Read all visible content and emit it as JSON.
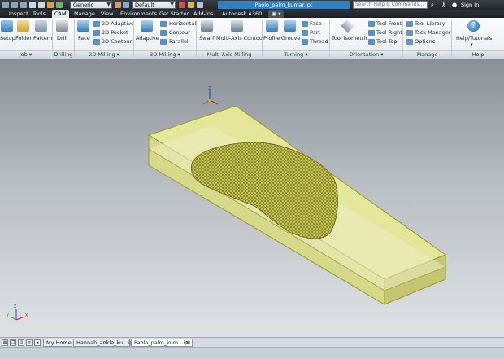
{
  "quick_access": {
    "material_combo": "Generic",
    "appearance_combo": "Default"
  },
  "window": {
    "doc_title": "Paolo_palm_kumar.ipt",
    "search_placeholder": "Search Help & Commands...",
    "sign_in": "Sign In"
  },
  "tabs": [
    {
      "label": "Inspect"
    },
    {
      "label": "Tools"
    },
    {
      "label": "CAM"
    },
    {
      "label": "Manage"
    },
    {
      "label": "View"
    },
    {
      "label": "Environments"
    },
    {
      "label": "Get Started"
    },
    {
      "label": "Add-Ins"
    },
    {
      "label": "Autodesk A360"
    }
  ],
  "ribbon": {
    "job": {
      "label": "Job",
      "setup": "Setup",
      "folder": "Folder",
      "pattern": "Pattern"
    },
    "drilling": {
      "label": "Drilling",
      "drill": "Drill"
    },
    "milling2d": {
      "label": "2D Milling",
      "face": "Face",
      "adaptive": "2D Adaptive",
      "pocket": "2D Pocket",
      "contour": "2D Contour"
    },
    "milling3d": {
      "label": "3D Milling",
      "adaptive": "Adaptive",
      "horizontal": "Horizontal",
      "contour": "Contour",
      "parallel": "Parallel"
    },
    "multiaxis": {
      "label": "Multi-Axis Milling",
      "swarf": "Swarf",
      "multiaxis_contour": "Multi-Axis Contour"
    },
    "turning": {
      "label": "Turning",
      "profile": "Profile",
      "groove": "Groove",
      "face": "Face",
      "part": "Part",
      "thread": "Thread"
    },
    "orientation": {
      "label": "Orientation",
      "tool_isometric": "Tool Isometric",
      "tool_front": "Tool Front",
      "tool_right": "Tool Right",
      "tool_top": "Tool Top"
    },
    "manage": {
      "label": "Manage",
      "tool_library": "Tool Library",
      "task_manager": "Task Manager",
      "options": "Options"
    },
    "help": {
      "label": "Help",
      "help_tutorials": "Help/Tutorials"
    }
  },
  "viewport": {
    "axis_x": "X",
    "axis_y": "Y",
    "axis_z": "Z"
  },
  "doc_tabs": [
    {
      "label": "My Home"
    },
    {
      "label": "Hannah_ankle_ku...ipt"
    },
    {
      "label": "Paolo_palm_kum...ipt"
    }
  ],
  "colors": {
    "stock": "#e6e89a",
    "stock_edge": "#9a9a2a",
    "mesh": "#c9c64e",
    "ribbon_blue": "#2f7fc1"
  }
}
